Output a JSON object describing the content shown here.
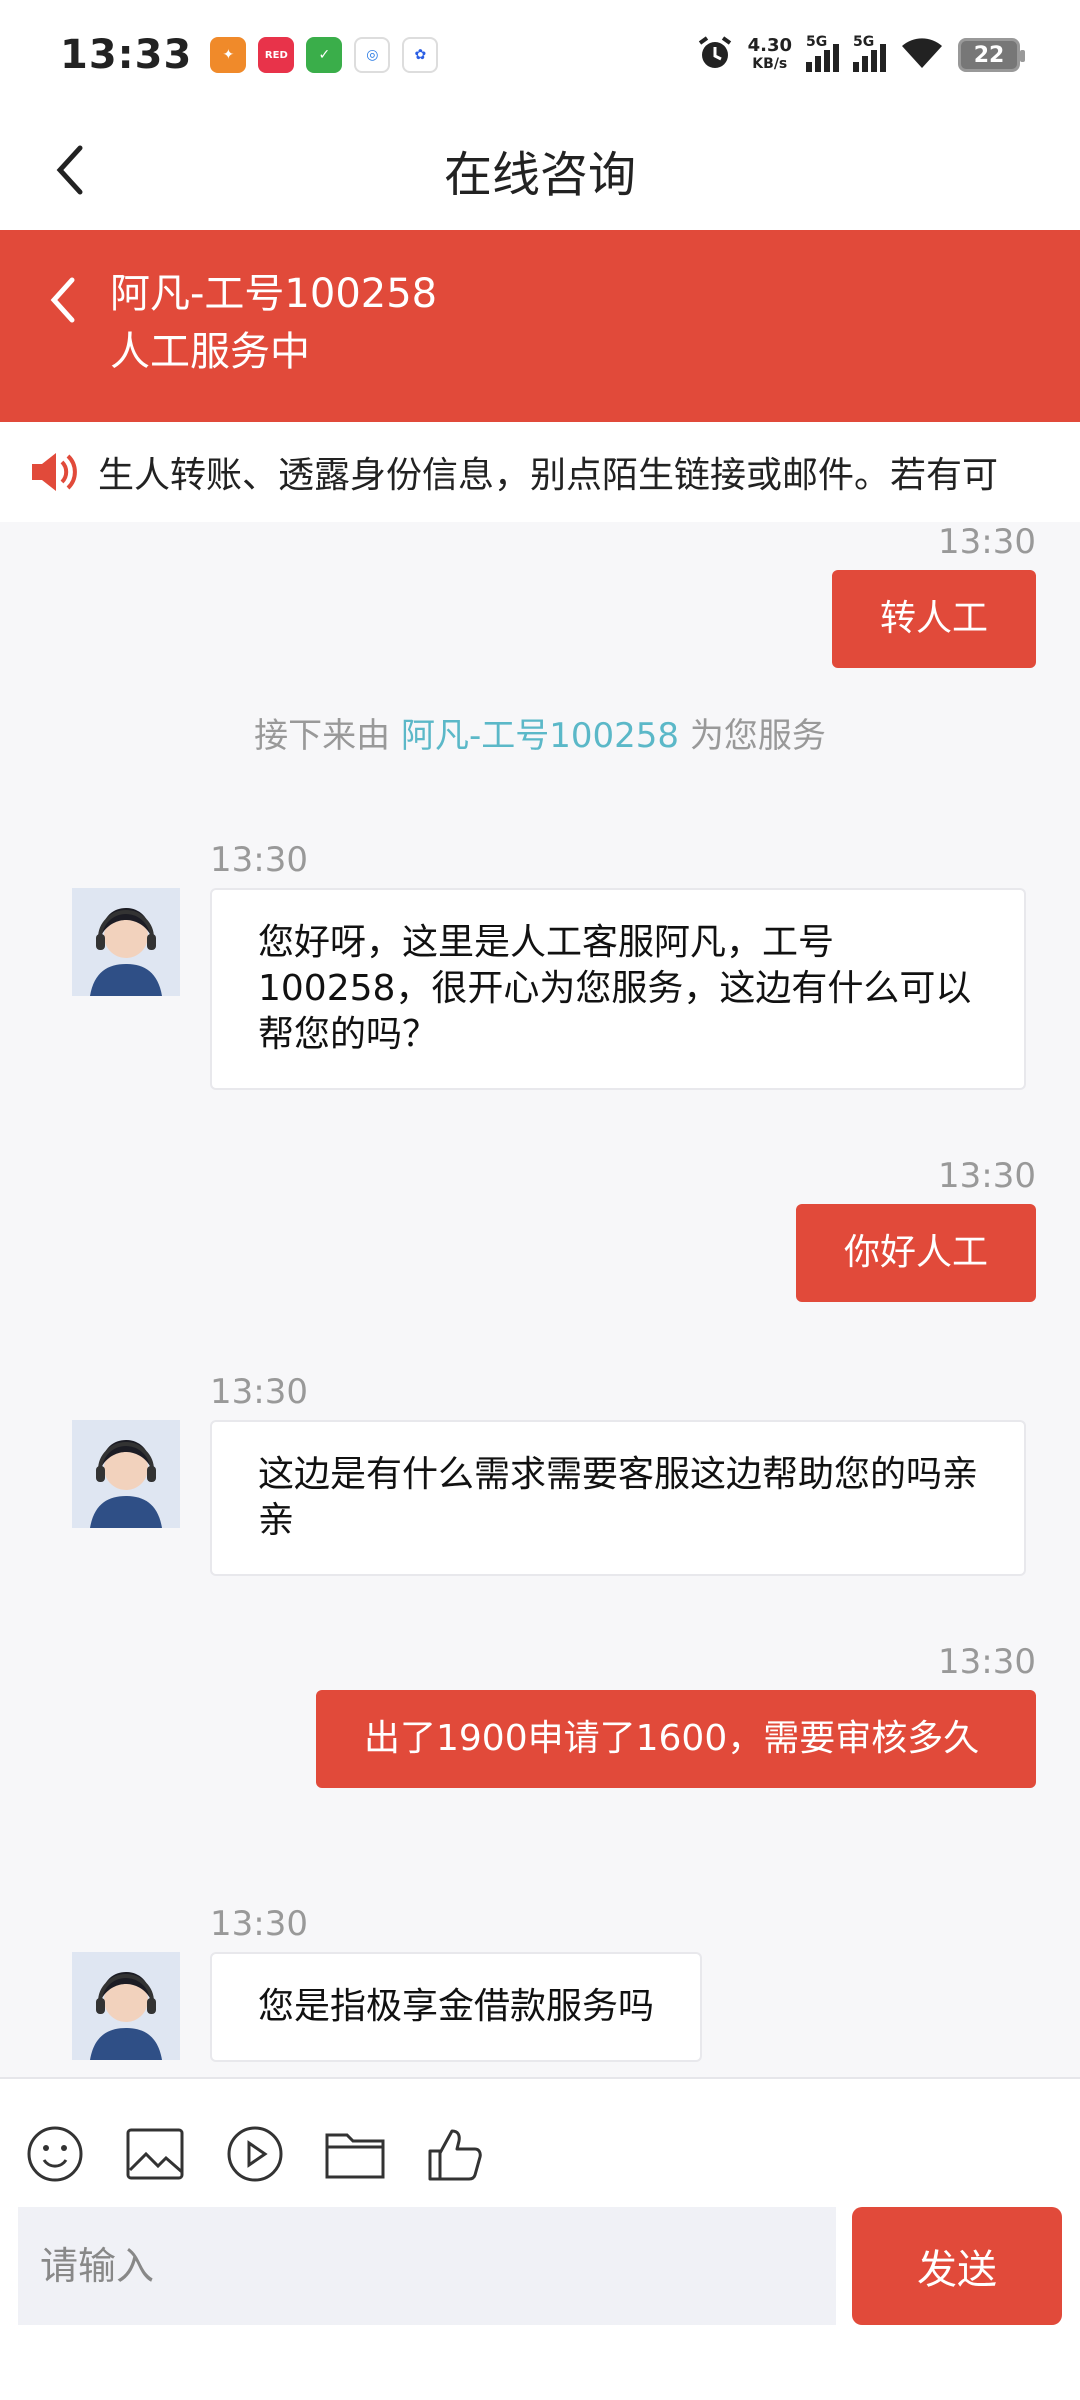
{
  "status_bar": {
    "time": "13:33",
    "speed_value": "4.30",
    "speed_unit": "KB/s",
    "sim1": "5G",
    "sim2": "5G",
    "battery": "22"
  },
  "header": {
    "title": "在线咨询"
  },
  "agent": {
    "name": "阿凡-工号100258",
    "status": "人工服务中"
  },
  "notice": {
    "text": "生人转账、透露身份信息，别点陌生链接或邮件。若有可"
  },
  "messages": [
    {
      "time": "13:30",
      "text": "转人工"
    },
    {
      "system_prefix": "接下来由 ",
      "system_agent": "阿凡-工号100258",
      "system_suffix": " 为您服务"
    },
    {
      "time": "13:30",
      "text": "您好呀，这里是人工客服阿凡，工号100258，很开心为您服务，这边有什么可以帮您的吗？"
    },
    {
      "time": "13:30",
      "text": "你好人工"
    },
    {
      "time": "13:30",
      "text": "这边是有什么需求需要客服这边帮助您的吗亲亲"
    },
    {
      "time": "13:30",
      "text": "出了1900申请了1600，需要审核多久"
    },
    {
      "time": "13:30",
      "text": "您是指极享金借款服务吗"
    }
  ],
  "input": {
    "placeholder": "请输入",
    "send_label": "发送"
  },
  "colors": {
    "accent": "#e14a3a",
    "link": "#5bb8c8"
  }
}
